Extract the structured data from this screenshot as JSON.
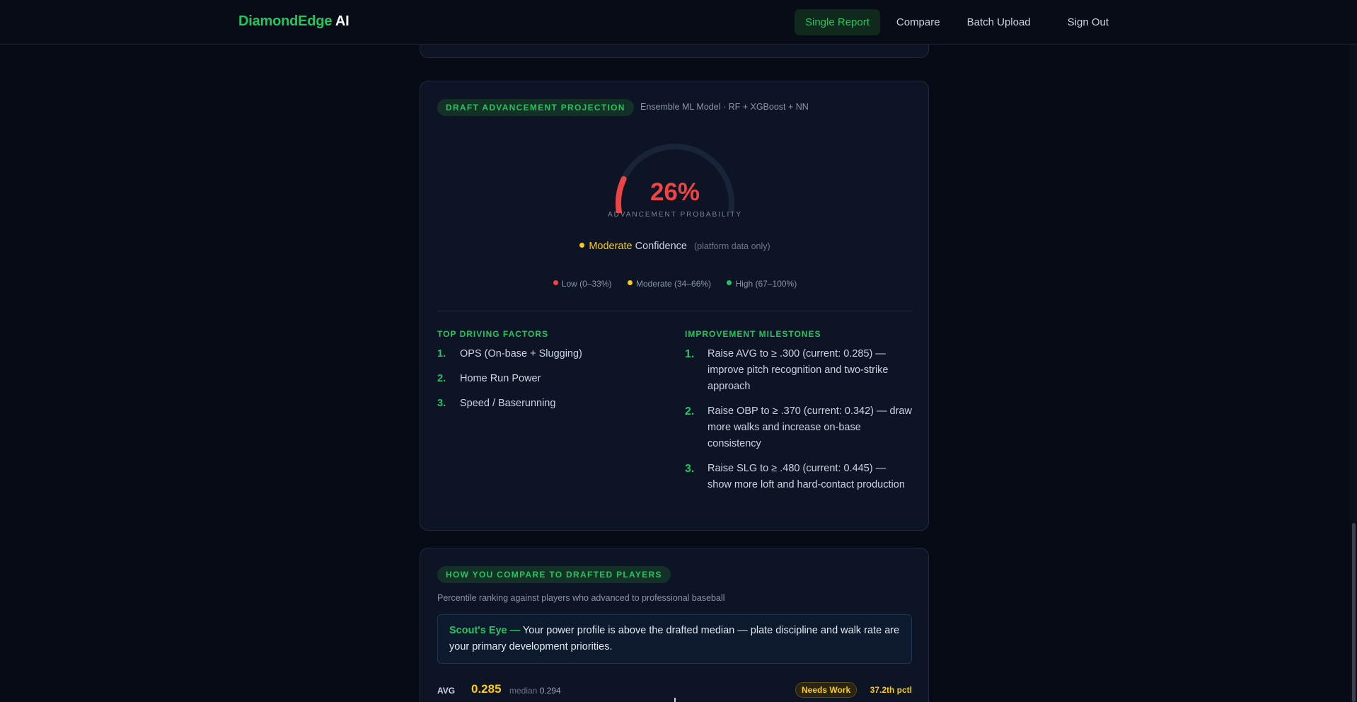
{
  "brand": {
    "part1": "DiamondEdge",
    "part2": "AI"
  },
  "nav": {
    "items": [
      {
        "label": "Single Report",
        "active": true
      },
      {
        "label": "Compare",
        "active": false
      },
      {
        "label": "Batch Upload",
        "active": false
      }
    ],
    "sign_out": "Sign Out"
  },
  "draft": {
    "pill": "DRAFT ADVANCEMENT PROJECTION",
    "model": "Ensemble ML Model · RF + XGBoost + NN",
    "gauge": {
      "percent_label": "26%",
      "value": 26,
      "caption": "ADVANCEMENT PROBABILITY",
      "color": "#ef4444",
      "track_color": "#1a2438"
    },
    "confidence": {
      "level": "Moderate",
      "word": "Confidence",
      "note": "(platform data only)",
      "dot_color": "#facc15"
    },
    "legend": [
      {
        "label": "Low (0–33%)",
        "color": "#ef4444"
      },
      {
        "label": "Moderate (34–66%)",
        "color": "#facc15"
      },
      {
        "label": "High (67–100%)",
        "color": "#22c55e"
      }
    ],
    "factors_title": "TOP DRIVING FACTORS",
    "factors": [
      {
        "num": "1.",
        "text": "OPS (On-base + Slugging)"
      },
      {
        "num": "2.",
        "text": "Home Run Power"
      },
      {
        "num": "3.",
        "text": "Speed / Baserunning"
      }
    ],
    "milestones_title": "IMPROVEMENT MILESTONES",
    "milestones": [
      {
        "num": "1.",
        "text": "Raise AVG to ≥ .300 (current: 0.285) — improve pitch recognition and two-strike approach"
      },
      {
        "num": "2.",
        "text": "Raise OBP to ≥ .370 (current: 0.342) — draw more walks and increase on-base consistency"
      },
      {
        "num": "3.",
        "text": "Raise SLG to ≥ .480 (current: 0.445) — show more loft and hard-contact production"
      }
    ]
  },
  "compare": {
    "pill": "HOW YOU COMPARE TO DRAFTED PLAYERS",
    "subtitle": "Percentile ranking against players who advanced to professional baseball",
    "scout_label": "Scout's Eye —",
    "scout_text": " Your power profile is above the drafted median — plate discipline and walk rate are your primary development priorities.",
    "stat": {
      "name": "AVG",
      "value": "0.285",
      "median_label": "median",
      "median_value": "0.294",
      "badge": "Needs Work",
      "percentile": "37.2th pctl"
    }
  }
}
